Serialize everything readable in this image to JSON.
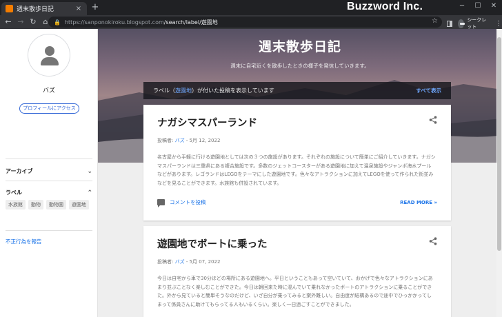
{
  "browser": {
    "tab_title": "週末散歩日記",
    "tab_close": "×",
    "new_tab": "+",
    "branding": "Buzzword Inc.",
    "url_host": "https://sanponokiroku.blogspot.com",
    "url_path": "/search/label/遊園地",
    "incognito_label": "シークレット",
    "win_minimize": "─",
    "win_maximize": "☐",
    "win_close": "✕"
  },
  "sidebar": {
    "profile_name": "バズ",
    "profile_button": "プロフィールにアクセス",
    "archive_heading": "アーカイブ",
    "labels_heading": "ラベル",
    "labels": [
      "水族館",
      "動物",
      "動物園",
      "遊園地"
    ],
    "report_link": "不正行為を報告"
  },
  "header": {
    "blog_title": "週末散歩日記",
    "description": "週末に自宅近くを散歩したときの様子を発信していきます。"
  },
  "label_bar": {
    "prefix": "ラベル（",
    "label": "遊園地",
    "suffix": "）が付いた投稿を表示しています",
    "show_all": "すべて表示"
  },
  "posts": [
    {
      "title": "ナガシマスパーランド",
      "meta_prefix": "投稿者: ",
      "author": "バズ",
      "date": " - 5月 12, 2022",
      "snippet": "名古屋から手軽に行ける遊園地としては次の３つの施設があります。それぞれの施設について簡単にご紹介していきます。ナガシマスパーランドは三重県にある複合施設です。多数のジェットコースターがある遊園地に加えて温泉施設やジャンボ海水プールなどがあります。レゴランドはLEGOをテーマにした遊園地です。色々なアトラクションに加えてLEGOを使って作られた街並みなどを見ることができます。水族館も併設されています。",
      "comment_label": "コメントを投稿",
      "read_more": "READ MORE »"
    },
    {
      "title": "遊園地でボートに乗った",
      "meta_prefix": "投稿者: ",
      "author": "バズ",
      "date": " - 5月 07, 2022",
      "snippet": "今日は自宅から車で30分ほどの場所にある遊園地へ。平日ということもあって空いていて、おかげで色々なアトラクションにあまり並ぶことなく楽しむことができた。今日は朝回来た時に混んでいて乗れなかったボートのアトラクションに乗ることができた。外から見ていると簡単そうなのだけど、いざ自分が乗ってみると案外難しい。自由度が結構あるので途中でひっかかってしまって係員さんに助けてもらってる人もいるくらい。楽しく一日過ごすことができました。"
    }
  ],
  "colors": {
    "accent": "#1a73e8",
    "chrome_dark": "#202124",
    "chrome_toolbar": "#35363a",
    "label_bar_bg": "#16161c"
  },
  "icons": [
    "back-arrow-icon",
    "forward-arrow-icon",
    "reload-icon",
    "home-icon",
    "lock-icon",
    "star-icon",
    "side-panel-icon",
    "incognito-icon",
    "kebab-menu-icon",
    "share-icon",
    "comment-icon",
    "chevron-down-icon",
    "chevron-up-icon",
    "avatar-icon"
  ]
}
